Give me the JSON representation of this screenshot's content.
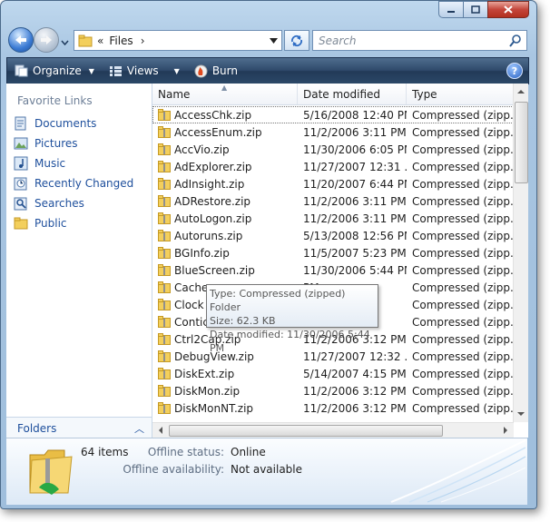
{
  "address": {
    "prefix": "«",
    "location": "Files",
    "separator": "›"
  },
  "search": {
    "placeholder": "Search"
  },
  "toolbar": {
    "organize": "Organize",
    "views": "Views",
    "burn": "Burn"
  },
  "nav": {
    "title": "Favorite Links",
    "items": [
      {
        "label": "Documents",
        "icon": "documents-icon"
      },
      {
        "label": "Pictures",
        "icon": "pictures-icon"
      },
      {
        "label": "Music",
        "icon": "music-icon"
      },
      {
        "label": "Recently Changed",
        "icon": "recently-changed-icon"
      },
      {
        "label": "Searches",
        "icon": "searches-icon"
      },
      {
        "label": "Public",
        "icon": "public-folder-icon"
      }
    ],
    "folders_label": "Folders"
  },
  "columns": {
    "name": "Name",
    "date": "Date modified",
    "type": "Type"
  },
  "files": [
    {
      "name": "AccessChk.zip",
      "date": "5/16/2008 12:40 PM",
      "type": "Compressed (zipp..."
    },
    {
      "name": "AccessEnum.zip",
      "date": "11/2/2006 3:11 PM",
      "type": "Compressed (zipp..."
    },
    {
      "name": "AccVio.zip",
      "date": "11/30/2006 6:05 PM",
      "type": "Compressed (zipp..."
    },
    {
      "name": "AdExplorer.zip",
      "date": "11/27/2007 12:31 ...",
      "type": "Compressed (zipp..."
    },
    {
      "name": "AdInsight.zip",
      "date": "11/20/2007 6:44 PM",
      "type": "Compressed (zipp..."
    },
    {
      "name": "ADRestore.zip",
      "date": "11/2/2006 3:11 PM",
      "type": "Compressed (zipp..."
    },
    {
      "name": "AutoLogon.zip",
      "date": "11/2/2006 3:11 PM",
      "type": "Compressed (zipp..."
    },
    {
      "name": "Autoruns.zip",
      "date": "5/13/2008 12:56 PM",
      "type": "Compressed (zipp..."
    },
    {
      "name": "BGInfo.zip",
      "date": "11/5/2007 5:23 PM",
      "type": "Compressed (zipp..."
    },
    {
      "name": "BlueScreen.zip",
      "date": "11/30/2006 5:44 PM",
      "type": "Compressed (zipp..."
    },
    {
      "name": "Cache",
      "date": "PM",
      "type": "Compressed (zipp..."
    },
    {
      "name": "Clock",
      "date": "PM",
      "type": "Compressed (zipp..."
    },
    {
      "name": "Contic",
      "date": "AM",
      "type": "Compressed (zipp..."
    },
    {
      "name": "Ctrl2Cap.zip",
      "date": "11/2/2006 3:12 PM",
      "type": "Compressed (zipp..."
    },
    {
      "name": "DebugView.zip",
      "date": "11/27/2007 12:32 ...",
      "type": "Compressed (zipp..."
    },
    {
      "name": "DiskExt.zip",
      "date": "5/14/2007 4:15 PM",
      "type": "Compressed (zipp..."
    },
    {
      "name": "DiskMon.zip",
      "date": "11/2/2006 3:12 PM",
      "type": "Compressed (zipp..."
    },
    {
      "name": "DiskMonNT.zip",
      "date": "11/2/2006 3:12 PM",
      "type": "Compressed (zipp..."
    }
  ],
  "tooltip": {
    "type": "Type: Compressed (zipped) Folder",
    "size": "Size: 62.3 KB",
    "date": "Date modified: 11/30/2006 5:44 PM"
  },
  "details": {
    "count": "64 items",
    "offline_status_label": "Offline status:",
    "offline_status_value": "Online",
    "offline_availability_label": "Offline availability:",
    "offline_availability_value": "Not available"
  },
  "colors": {
    "link": "#1e4f9c",
    "cmdbar": "#2f4a6b",
    "folder": "#f3cf5c"
  }
}
